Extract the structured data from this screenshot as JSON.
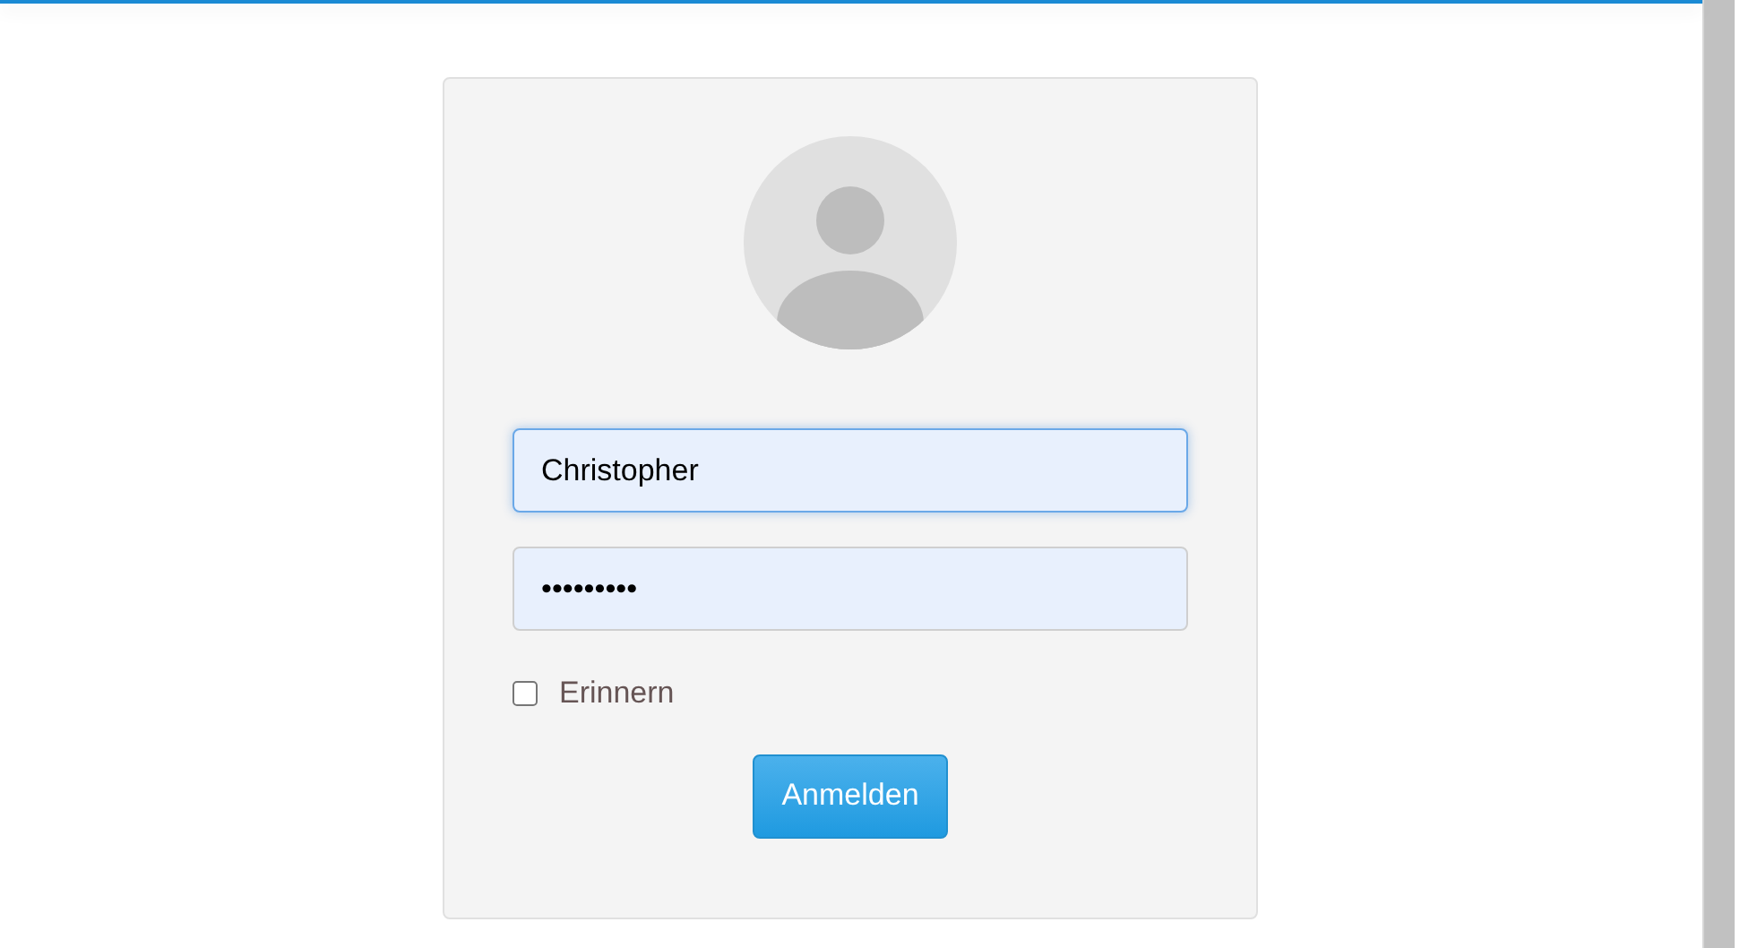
{
  "login_form": {
    "username": {
      "value": "Christopher",
      "focused": true
    },
    "password": {
      "value": "•••••••••",
      "focused": false
    },
    "remember": {
      "label": "Erinnern",
      "checked": false
    },
    "submit": {
      "label": "Anmelden"
    }
  }
}
